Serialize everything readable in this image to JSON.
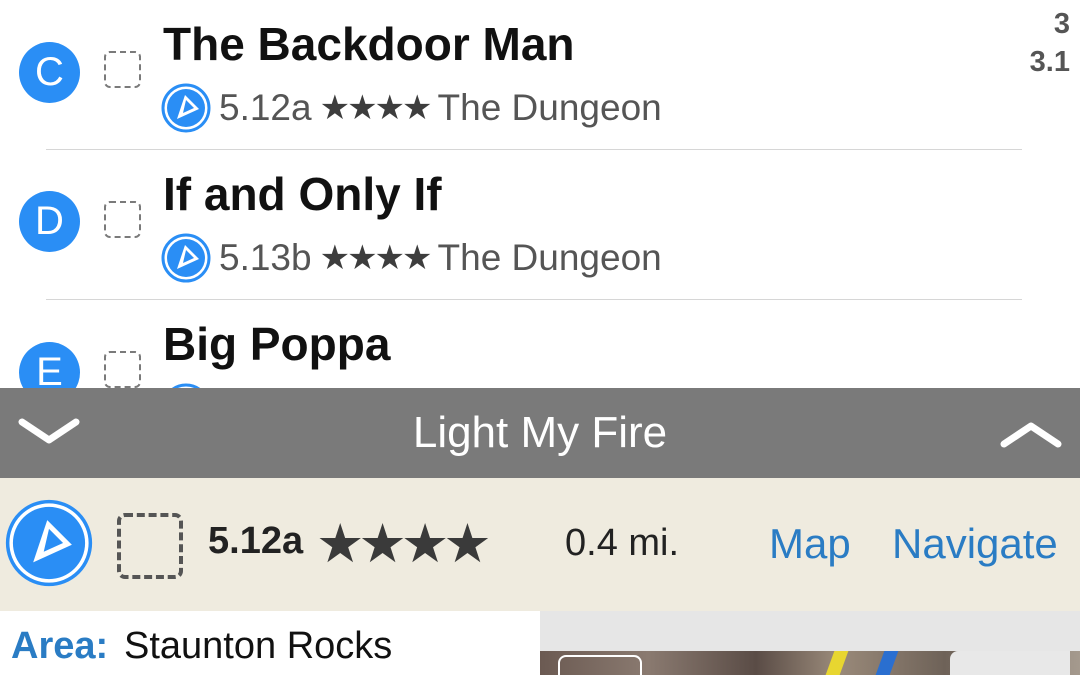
{
  "routes": [
    {
      "letter": "C",
      "name": "The Backdoor Man",
      "grade": "5.12a",
      "stars": "★★★★",
      "area": "The Dungeon"
    },
    {
      "letter": "D",
      "name": "If and Only If",
      "grade": "5.13b",
      "stars": "★★★★",
      "area": "The Dungeon"
    },
    {
      "letter": "E",
      "name": "Big Poppa",
      "grade": "",
      "stars": "",
      "area": ""
    }
  ],
  "side_info": {
    "line1": "3",
    "line2": "3.1"
  },
  "selected": {
    "title": "Light My Fire",
    "grade": "5.12a",
    "stars": "★★★★",
    "distance": "0.4 mi.",
    "map_label": "Map",
    "navigate_label": "Navigate",
    "area_label": "Area:",
    "area_value": "Staunton Rocks"
  },
  "colors": {
    "accent": "#2a8ef5",
    "link": "#2a7cc4",
    "bar": "#7a7a7a",
    "panel": "#efebdf"
  },
  "icons": {
    "collapse": "chevron-down-icon",
    "expand": "chevron-up-icon",
    "route_logo": "mountain-project-logo-icon",
    "checkbox": "checkbox-icon"
  }
}
